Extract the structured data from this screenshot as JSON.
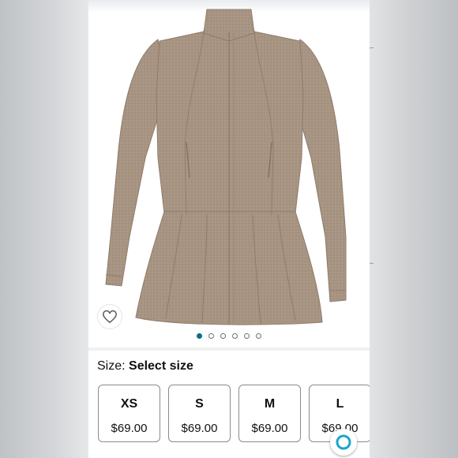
{
  "product": {
    "image_alt": "taupe zip jacket with peplum hem",
    "colors": {
      "fabric": "#a89482",
      "fabric_dark": "#8e7b6b"
    }
  },
  "wishlist": {
    "icon": "heart-outline-icon"
  },
  "carousel": {
    "count": 6,
    "active_index": 0,
    "active_color": "#007185"
  },
  "size": {
    "label": "Size: ",
    "value": "Select size",
    "options": [
      {
        "size": "XS",
        "price": "$69.00"
      },
      {
        "size": "S",
        "price": "$69.00"
      },
      {
        "size": "M",
        "price": "$69.00"
      },
      {
        "size": "L",
        "price": "$69.00"
      }
    ]
  },
  "assistant": {
    "icon": "alexa-ring-icon",
    "color": "#1aa6c9"
  }
}
